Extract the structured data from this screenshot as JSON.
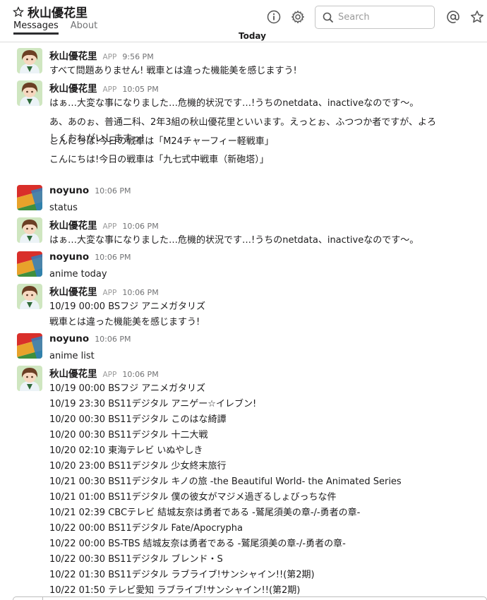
{
  "header": {
    "channel_title": "秋山優花里",
    "tabs": [
      {
        "label": "Messages",
        "active": true
      },
      {
        "label": "About",
        "active": false
      }
    ],
    "search_placeholder": "Search",
    "icons": [
      "star-icon",
      "info-icon",
      "gear-icon",
      "search-icon",
      "at-mention-icon",
      "star-outline-icon"
    ]
  },
  "day_divider": "Today",
  "messages": [
    {
      "sender": "秋山優花里",
      "app": "APP",
      "time": "9:56 PM",
      "avatar": "character",
      "lines": [
        "すべて問題ありません! 戦車とは違った機能美を感じますう!"
      ]
    },
    {
      "sender": "秋山優花里",
      "app": "APP",
      "time": "10:05 PM",
      "avatar": "character",
      "lines": [
        "はぁ…大変な事になりました…危機的状況です…!うちのnetdata、inactiveなのです〜。",
        "あ、あのぉ、普通二科、2年3組の秋山優花里といいます。えっとぉ、ふつつか者ですが、よろしくおねがいしますっ!",
        "こんにちは!今日の戦車は「M24チャーフィー軽戦車」",
        "こんにちは!今日の戦車は「九七式中戦車（新砲塔）」"
      ]
    },
    {
      "sender": "noyuno",
      "app": "",
      "time": "10:06 PM",
      "avatar": "noyuno",
      "lines": [
        "status"
      ]
    },
    {
      "sender": "秋山優花里",
      "app": "APP",
      "time": "10:06 PM",
      "avatar": "character",
      "lines": [
        "はぁ…大変な事になりました…危機的状況です…!うちのnetdata、inactiveなのです〜。"
      ]
    },
    {
      "sender": "noyuno",
      "app": "",
      "time": "10:06 PM",
      "avatar": "noyuno",
      "lines": [
        "anime today"
      ]
    },
    {
      "sender": "秋山優花里",
      "app": "APP",
      "time": "10:06 PM",
      "avatar": "character",
      "lines": [
        "10/19 00:00 BSフジ アニメガタリズ",
        "戦車とは違った機能美を感じますう!"
      ]
    },
    {
      "sender": "noyuno",
      "app": "",
      "time": "10:06 PM",
      "avatar": "noyuno",
      "lines": [
        "anime list"
      ]
    },
    {
      "sender": "秋山優花里",
      "app": "APP",
      "time": "10:06 PM",
      "avatar": "character",
      "lines": [
        "10/19 00:00 BSフジ アニメガタリズ",
        "10/19 23:30 BS11デジタル アニゲー☆イレブン!",
        "10/20 00:30 BS11デジタル このはな綺譚",
        "10/20 00:30 BS11デジタル 十二大戦",
        "10/20 02:10 東海テレビ いぬやしき",
        "10/20 23:00 BS11デジタル 少女終末旅行",
        "10/21 00:30 BS11デジタル キノの旅 -the Beautiful World- the Animated Series",
        "10/21 01:00 BS11デジタル 僕の彼女がマジメ過ぎるしょびっちな件",
        "10/21 02:39 CBCテレビ 結城友奈は勇者である -鷲尾須美の章-/-勇者の章-",
        "10/22 00:00 BS11デジタル Fate/Apocrypha",
        "10/22 00:00 BS-TBS 結城友奈は勇者である -鷲尾須美の章-/-勇者の章-",
        "10/22 00:30 BS11デジタル ブレンド・S",
        "10/22 01:30 BS11デジタル ラブライブ!サンシャイン!!(第2期)",
        "10/22 01:50 テレビ愛知 ラブライブ!サンシャイン!!(第2期)"
      ]
    }
  ]
}
